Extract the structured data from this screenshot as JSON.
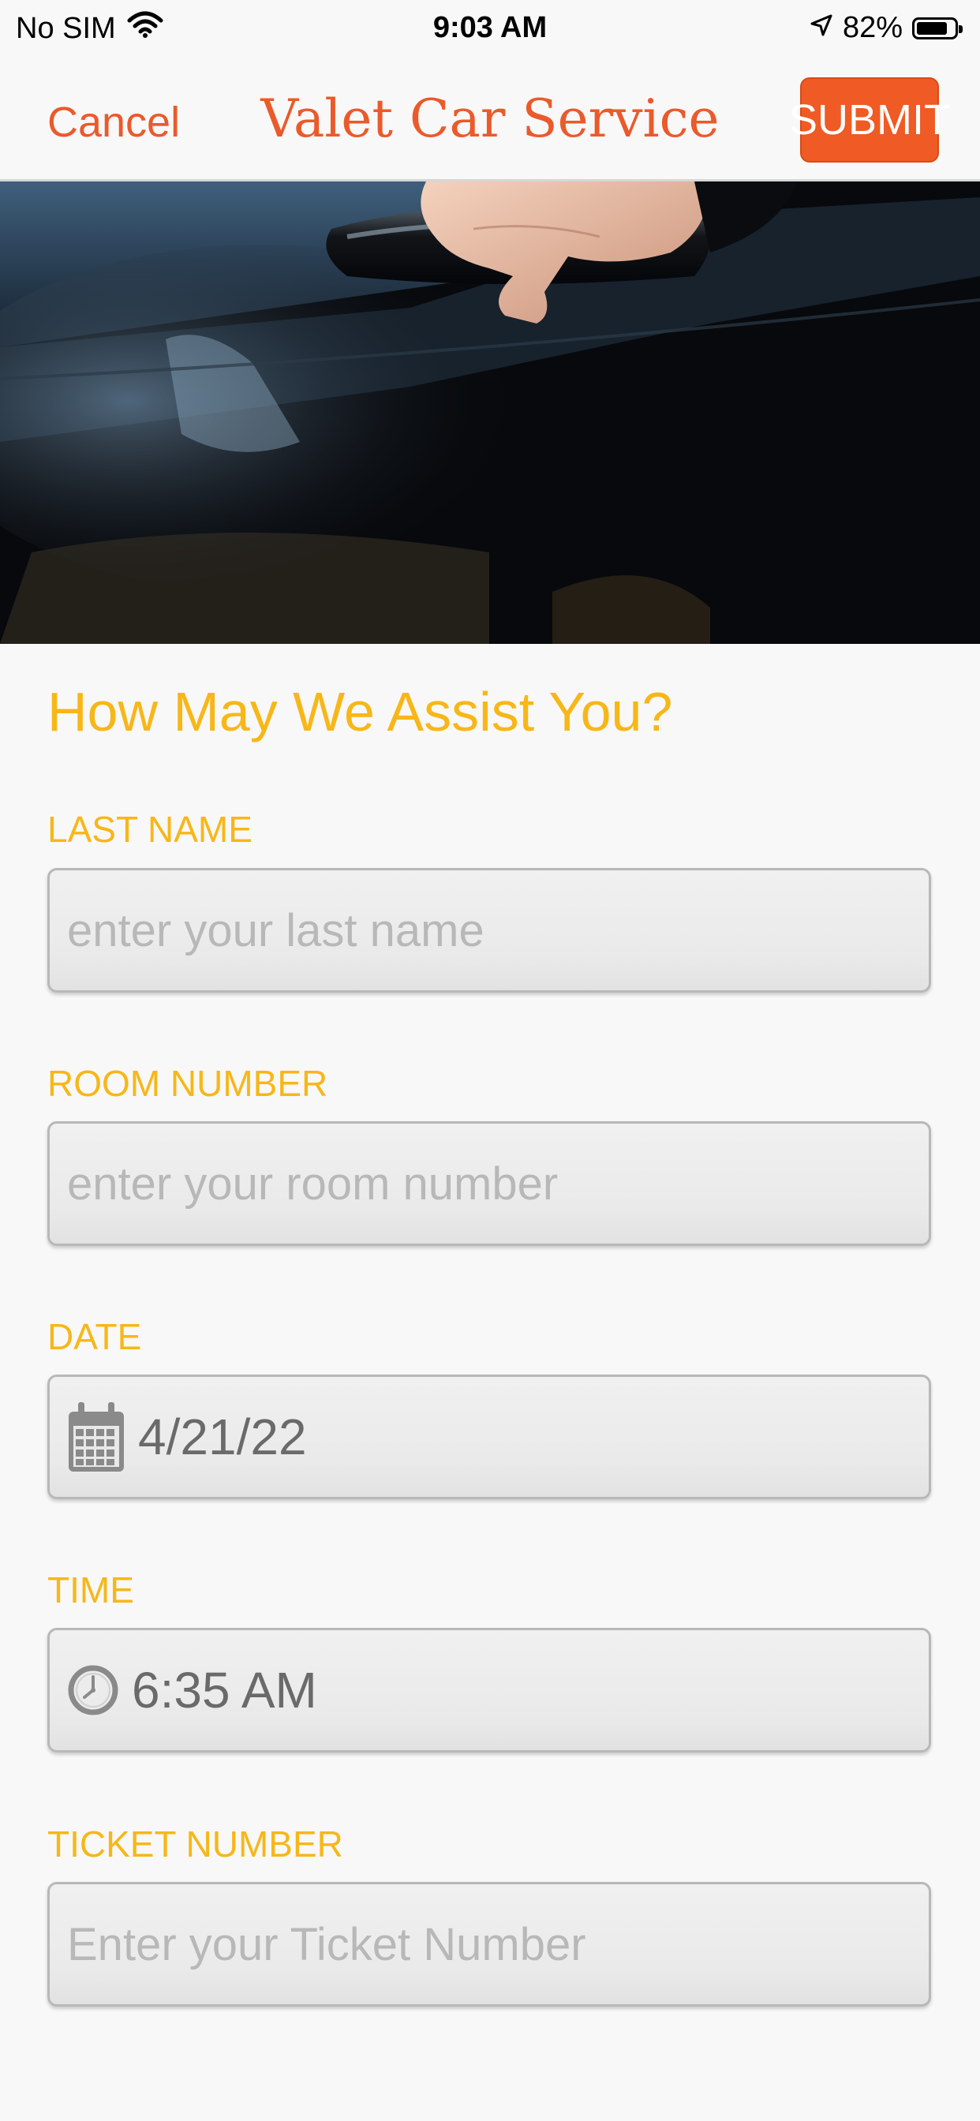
{
  "status_bar": {
    "carrier": "No SIM",
    "time": "9:03 AM",
    "battery_percent": "82%",
    "battery_level": 0.82,
    "icons": [
      "wifi-icon",
      "location-arrow-icon",
      "battery-icon"
    ]
  },
  "nav": {
    "cancel_label": "Cancel",
    "title": "Valet Car Service",
    "submit_label": "SUBMIT"
  },
  "hero": {
    "description_icon": "car-door-handle-photo"
  },
  "form": {
    "heading": "How May We Assist You?",
    "fields": [
      {
        "label": "LAST NAME",
        "value": "",
        "placeholder": "enter your last name"
      },
      {
        "label": "ROOM NUMBER",
        "value": "",
        "placeholder": "enter your room number"
      },
      {
        "label": "DATE",
        "value": "4/21/22",
        "placeholder": "",
        "icon": "calendar-icon"
      },
      {
        "label": "TIME",
        "value": "6:35 AM",
        "placeholder": "",
        "icon": "clock-icon"
      },
      {
        "label": "TICKET NUMBER",
        "value": "",
        "placeholder": "Enter your Ticket Number"
      }
    ]
  },
  "colors": {
    "accent_orange": "#ea5a2b",
    "submit_bg": "#f05a24",
    "label_yellow": "#f7b718",
    "placeholder_gray": "#b8b8b8",
    "value_gray": "#6a6a6a"
  }
}
